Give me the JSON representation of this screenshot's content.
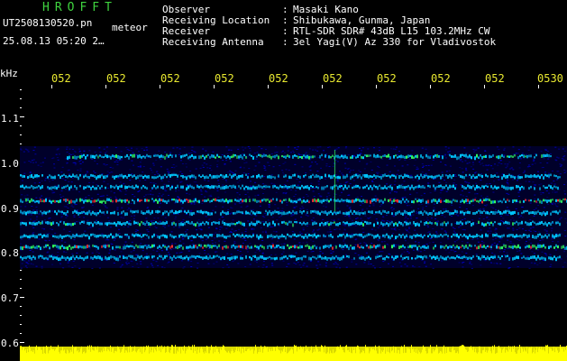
{
  "header": {
    "brand": "HROFFT",
    "filename": "UT2508130520.pn",
    "mode": "meteor",
    "datetime": "25.08.13 05:20   2…",
    "info": [
      {
        "label": "Observer",
        "sep": ":",
        "value": "Masaki Kano"
      },
      {
        "label": "Receiving Location",
        "sep": ":",
        "value": "Shibukawa, Gunma, Japan"
      },
      {
        "label": "Receiver",
        "sep": ":",
        "value": "RTL-SDR SDR# 43dB L15 103.2MHz CW"
      },
      {
        "label": "Receiving Antenna",
        "sep": ":",
        "value": "3el Yagi(V) Az 330 for Vladivostok"
      }
    ]
  },
  "axis": {
    "unit": "kHz",
    "time_ticks": [
      "052",
      "052",
      "052",
      "052",
      "052",
      "052",
      "052",
      "052",
      "052",
      "0530"
    ],
    "freq_ticks": [
      "1.1",
      "1.0",
      "0.9",
      "0.8",
      "0.7",
      "0.6"
    ]
  },
  "colors": {
    "brand": "#3fd33f",
    "ticks": "#e8e830",
    "text": "#ffffff",
    "background": "#000000",
    "noise": "#0000c8",
    "signal_low": "#00c8ff",
    "signal_mid": "#30ff60",
    "signal_high": "#ff3030",
    "meter": "#ffff00"
  }
}
